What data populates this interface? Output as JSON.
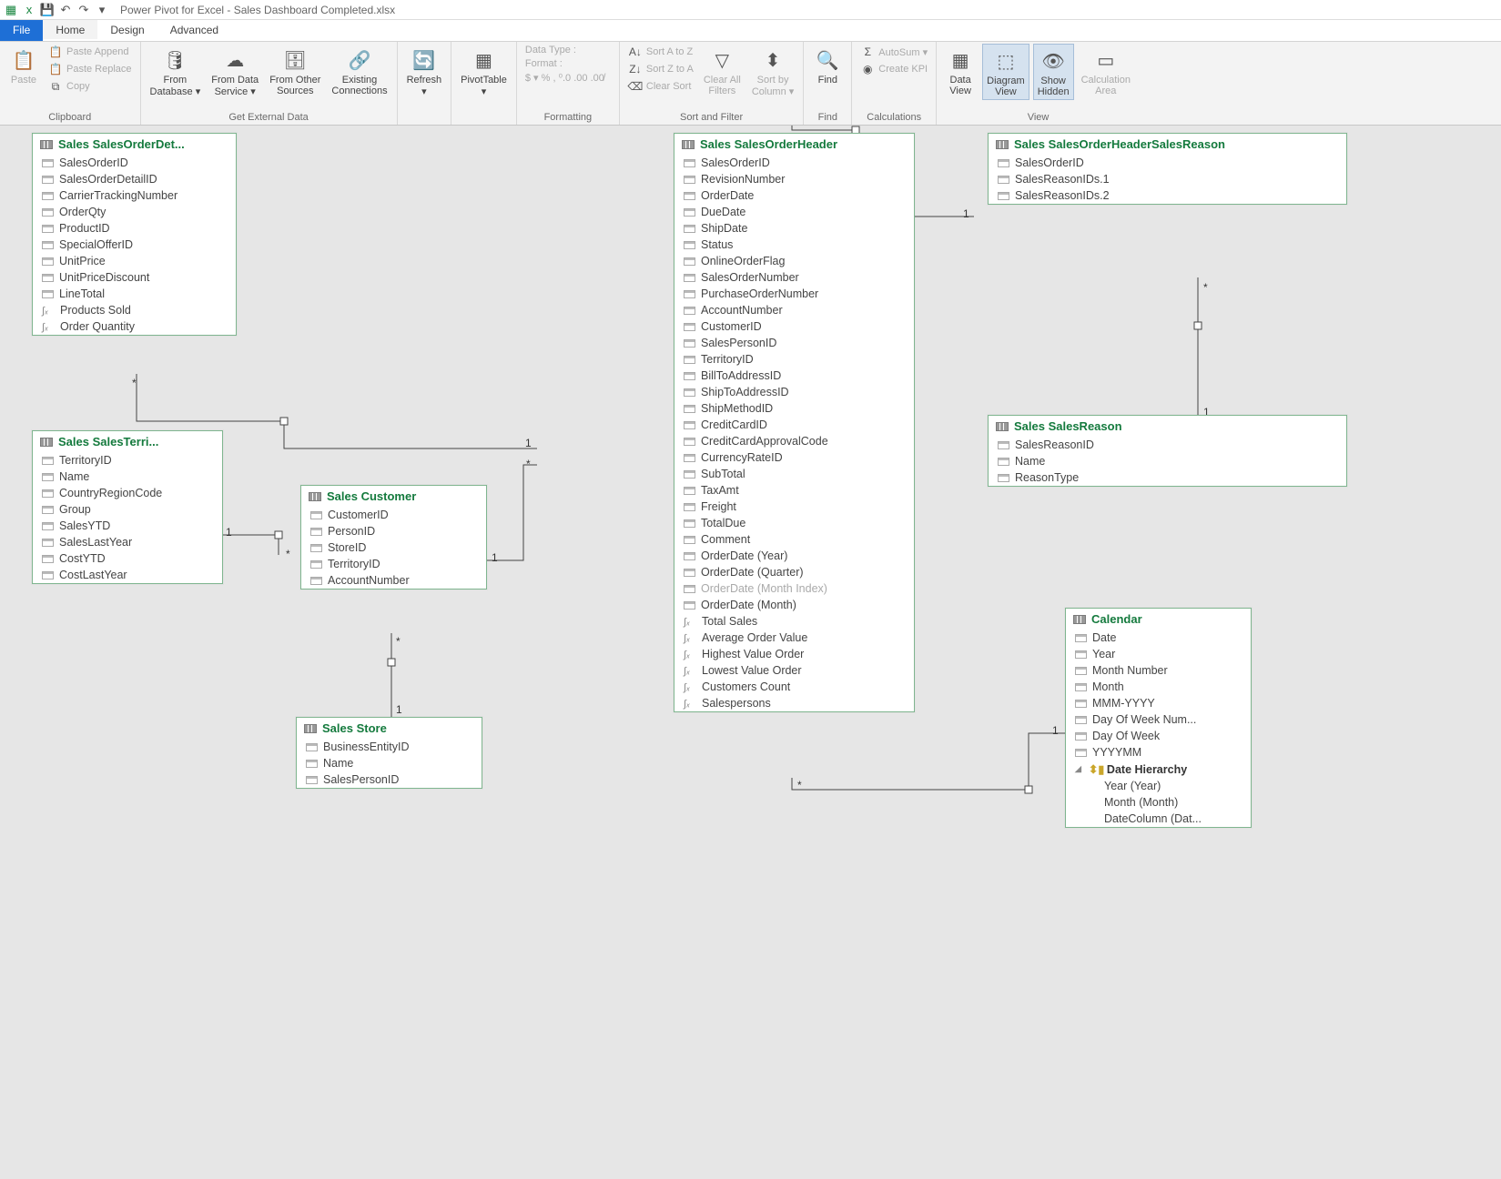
{
  "title": "Power Pivot for Excel - Sales Dashboard Completed.xlsx",
  "tabs": {
    "file": "File",
    "home": "Home",
    "design": "Design",
    "advanced": "Advanced"
  },
  "ribbon": {
    "clipboard": {
      "label": "Clipboard",
      "paste": "Paste",
      "paste_append": "Paste Append",
      "paste_replace": "Paste Replace",
      "copy": "Copy"
    },
    "external": {
      "label": "Get External Data",
      "from_db": "From\nDatabase ▾",
      "from_ds": "From Data\nService ▾",
      "from_other": "From Other\nSources",
      "existing": "Existing\nConnections"
    },
    "refresh": "Refresh\n▾",
    "pivot": "PivotTable\n▾",
    "formatting": {
      "label": "Formatting",
      "data_type": "Data Type : ",
      "format": "Format : ",
      "syms": "$ ▾ % , ⁰.0 .00 .00̸"
    },
    "sort": {
      "label": "Sort and Filter",
      "az": "Sort A to Z",
      "za": "Sort Z to A",
      "clear_sort": "Clear Sort",
      "clear_filters": "Clear All\nFilters",
      "sort_by_col": "Sort by\nColumn ▾"
    },
    "find": {
      "label": "Find",
      "btn": "Find"
    },
    "calc": {
      "label": "Calculations",
      "autosum": "AutoSum ▾",
      "kpi": "Create KPI"
    },
    "view": {
      "label": "View",
      "data_view": "Data\nView",
      "diagram_view": "Diagram\nView",
      "show_hidden": "Show\nHidden",
      "calc_area": "Calculation\nArea"
    }
  },
  "entities": {
    "orderDetail": {
      "title": "Sales SalesOrderDet...",
      "cols": [
        "SalesOrderID",
        "SalesOrderDetailID",
        "CarrierTrackingNumber",
        "OrderQty",
        "ProductID",
        "SpecialOfferID",
        "UnitPrice",
        "UnitPriceDiscount",
        "LineTotal"
      ],
      "measures": [
        "Products Sold",
        "Order Quantity"
      ]
    },
    "territory": {
      "title": "Sales SalesTerri...",
      "cols": [
        "TerritoryID",
        "Name",
        "CountryRegionCode",
        "Group",
        "SalesYTD",
        "SalesLastYear",
        "CostYTD",
        "CostLastYear"
      ]
    },
    "customer": {
      "title": "Sales Customer",
      "cols": [
        "CustomerID",
        "PersonID",
        "StoreID",
        "TerritoryID",
        "AccountNumber"
      ]
    },
    "store": {
      "title": "Sales Store",
      "cols": [
        "BusinessEntityID",
        "Name",
        "SalesPersonID"
      ]
    },
    "orderHeader": {
      "title": "Sales SalesOrderHeader",
      "cols": [
        "SalesOrderID",
        "RevisionNumber",
        "OrderDate",
        "DueDate",
        "ShipDate",
        "Status",
        "OnlineOrderFlag",
        "SalesOrderNumber",
        "PurchaseOrderNumber",
        "AccountNumber",
        "CustomerID",
        "SalesPersonID",
        "TerritoryID",
        "BillToAddressID",
        "ShipToAddressID",
        "ShipMethodID",
        "CreditCardID",
        "CreditCardApprovalCode",
        "CurrencyRateID",
        "SubTotal",
        "TaxAmt",
        "Freight",
        "TotalDue",
        "Comment",
        "OrderDate (Year)",
        "OrderDate (Quarter)"
      ],
      "dim": "OrderDate (Month Index)",
      "cols2": [
        "OrderDate (Month)"
      ],
      "measures": [
        "Total Sales",
        "Average Order Value",
        "Highest Value Order",
        "Lowest Value Order",
        "Customers Count",
        "Salespersons"
      ]
    },
    "headerReason": {
      "title": "Sales SalesOrderHeaderSalesReason",
      "cols": [
        "SalesOrderID",
        "SalesReasonIDs.1",
        "SalesReasonIDs.2"
      ]
    },
    "salesReason": {
      "title": "Sales SalesReason",
      "cols": [
        "SalesReasonID",
        "Name",
        "ReasonType"
      ]
    },
    "calendar": {
      "title": "Calendar",
      "cols": [
        "Date",
        "Year",
        "Month Number",
        "Month",
        "MMM-YYYY",
        "Day Of Week Num...",
        "Day Of Week",
        "YYYYMM"
      ],
      "hierarchy": {
        "name": "Date Hierarchy",
        "levels": [
          "Year (Year)",
          "Month (Month)",
          "DateColumn (Dat..."
        ]
      }
    }
  }
}
